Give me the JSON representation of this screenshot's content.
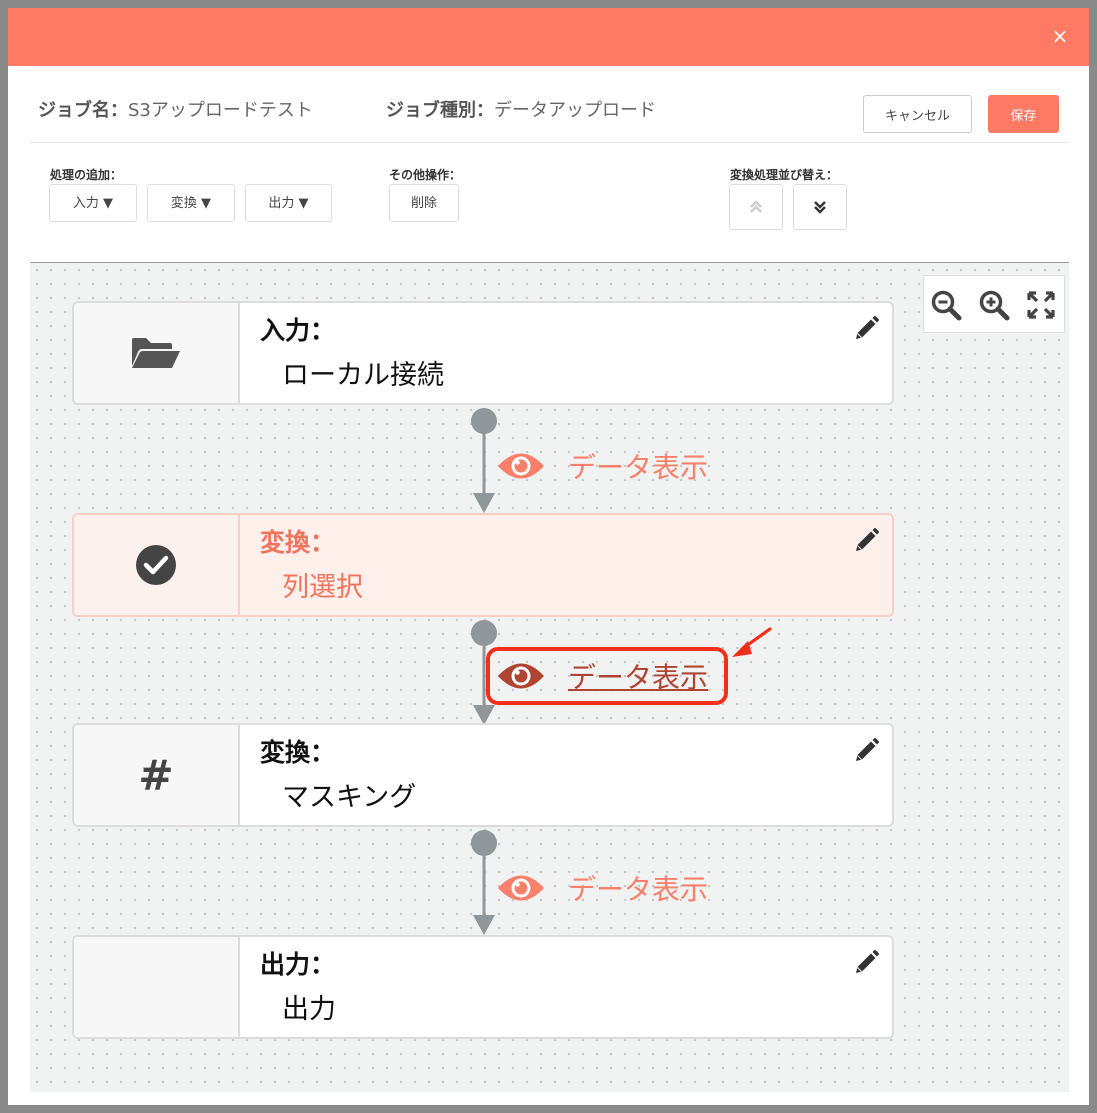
{
  "header": {
    "close_icon": "×"
  },
  "title_row": {
    "job_name_label": "ジョブ名：",
    "job_name_value": "S3アップロードテスト",
    "job_type_label": "ジョブ種別：",
    "job_type_value": "データアップロード",
    "cancel_label": "キャンセル",
    "save_label": "保存"
  },
  "ops": {
    "add_label": "処理の追加：",
    "input_btn": "入力 ▼",
    "transform_btn": "変換 ▼",
    "output_btn": "出力 ▼",
    "other_label": "その他操作：",
    "delete_btn": "削除",
    "sort_label": "変換処理並び替え："
  },
  "nodes": [
    {
      "type": "入力：",
      "name": "ローカル接続",
      "icon": "folder-open-icon"
    },
    {
      "type": "変換：",
      "name": "列選択",
      "icon": "check-circle-icon"
    },
    {
      "type": "変換：",
      "name": "マスキング",
      "icon": "hash-icon",
      "symbol": "#"
    },
    {
      "type": "出力：",
      "name": "出力"
    }
  ],
  "links": [
    {
      "label": "データ表示"
    },
    {
      "label": "データ表示"
    },
    {
      "label": "データ表示"
    }
  ],
  "colors": {
    "accent": "#ff7a64",
    "link": "#f8806a",
    "link_active": "#b04433",
    "highlight": "#f0301c"
  }
}
